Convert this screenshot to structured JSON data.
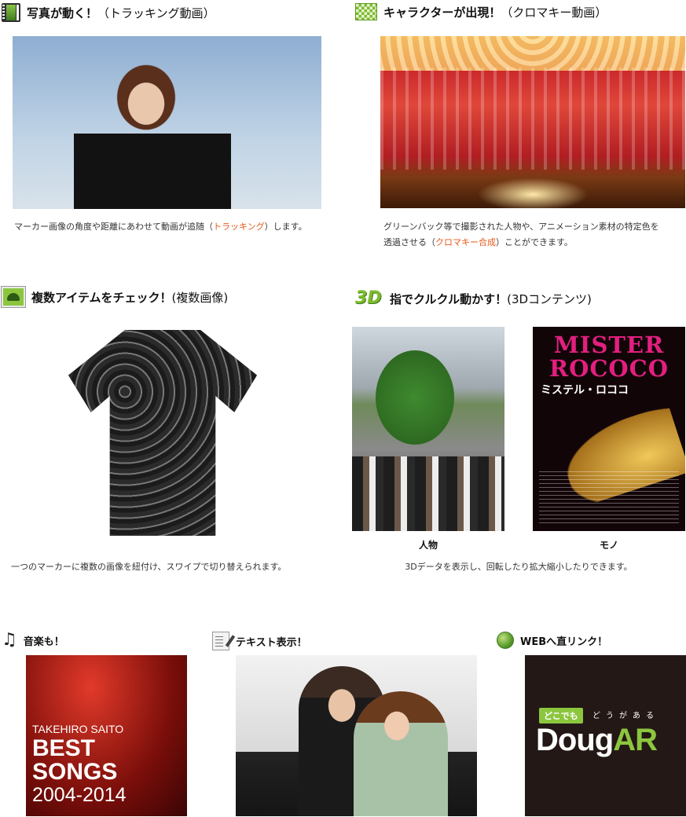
{
  "sections": {
    "tracking": {
      "icon": "film-icon",
      "title": "写真が動く！",
      "subtitle": "（トラッキング動画）",
      "desc_before": "マーカー画像の角度や距離にあわせて動画が追随（",
      "desc_highlight": "トラッキング",
      "desc_after": "）します。"
    },
    "chromakey": {
      "icon": "checker-icon",
      "title": "キャラクターが出現！",
      "subtitle": "（クロマキー動画）",
      "desc_line1": "グリーンバック等で撮影された人物や、アニメーション素材の特定色を",
      "desc_before": "透過させる（",
      "desc_highlight": "クロマキー合成",
      "desc_after": "）ことができます。"
    },
    "multi": {
      "icon": "photos-icon",
      "title": "複数アイテムをチェック！",
      "subtitle": "(複数画像)",
      "desc": "一つのマーカーに複数の画像を紐付け、スワイプで切り替えられます。"
    },
    "threed": {
      "icon": "3d-icon",
      "icon_text": "3D",
      "title": "指でクルクル動かす！",
      "subtitle": "(3Dコンテンツ)",
      "caption_person": "人物",
      "caption_thing": "モノ",
      "poster_title": "MISTER ROCOCO",
      "poster_subtitle": "ミステル・ロココ",
      "desc": "3Dデータを表示し、回転したり拡大縮小したりできます。"
    },
    "music": {
      "icon": "music-note-icon",
      "icon_glyph": "♫",
      "title": "音楽も！",
      "album_artist": "TAKEHIRO SAITO",
      "album_title_1": "BEST",
      "album_title_2": "SONGS",
      "album_years": "2004-2014"
    },
    "text": {
      "icon": "text-edit-icon",
      "title": "テキスト表示！"
    },
    "web": {
      "icon": "globe-icon",
      "title": "WEBへ直リンク！",
      "logo_tag": "どこでも",
      "logo_sub": "どうがある",
      "logo_main": "Doug",
      "logo_accent": "AR"
    }
  },
  "colors": {
    "highlight": "#e8581a",
    "brand_green": "#8cc63f"
  }
}
